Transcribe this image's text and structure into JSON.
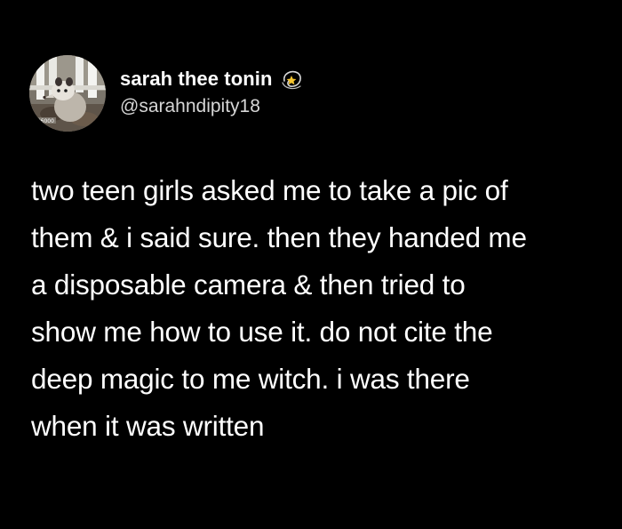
{
  "user": {
    "display_name": "sarah thee tonin",
    "handle": "@sarahndipity18",
    "name_emoji": "dizzy-star-emoji",
    "avatar": "opossum-avatar"
  },
  "tweet": {
    "text": "two teen girls asked me to take a pic of\nthem & i said sure. then they handed me\na disposable camera & then tried to\nshow me how to use it. do not cite the\ndeep magic to me witch. i was there\nwhen it was written"
  },
  "colors": {
    "background": "#000000",
    "text": "#ffffff",
    "handle": "#d6d6d6"
  }
}
